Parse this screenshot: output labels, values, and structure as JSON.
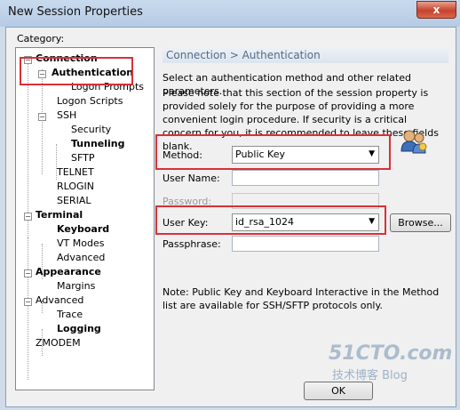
{
  "window": {
    "title": "New Session Properties",
    "close_glyph": "x"
  },
  "category_label": "Category:",
  "tree": [
    {
      "label": "Connection",
      "bold": true
    },
    {
      "label": "Authentication",
      "bold": true,
      "selected": true
    },
    {
      "label": "Logon Prompts"
    },
    {
      "label": "Logon Scripts"
    },
    {
      "label": "SSH"
    },
    {
      "label": "Security"
    },
    {
      "label": "Tunneling",
      "bold": true
    },
    {
      "label": "SFTP"
    },
    {
      "label": "TELNET"
    },
    {
      "label": "RLOGIN"
    },
    {
      "label": "SERIAL"
    },
    {
      "label": "Terminal",
      "bold": true
    },
    {
      "label": "Keyboard",
      "bold": true
    },
    {
      "label": "VT Modes"
    },
    {
      "label": "Advanced"
    },
    {
      "label": "Appearance",
      "bold": true
    },
    {
      "label": "Margins"
    },
    {
      "label": "Advanced"
    },
    {
      "label": "Trace"
    },
    {
      "label": "Logging",
      "bold": true
    },
    {
      "label": "ZMODEM"
    }
  ],
  "panel": {
    "header": "Connection > Authentication",
    "intro": "Select an authentication method and other related parameters.",
    "note": "Please note that this section of the session property is provided solely for the purpose of providing a more convenient login procedure. If security is a critical concern for you, it is recommended to leave these fields blank.",
    "method_label": "Method:",
    "method_value": "Public Key",
    "username_label": "User Name:",
    "username_value": "",
    "password_label": "Password:",
    "userkey_label": "User Key:",
    "userkey_value": "id_rsa_1024",
    "browse_label": "Browse...",
    "passphrase_label": "Passphrase:",
    "passphrase_value": "",
    "footer_note": "Note: Public Key and Keyboard Interactive in the Method list are available for SSH/SFTP protocols only."
  },
  "buttons": {
    "ok": "OK"
  },
  "watermark": {
    "line1": "51CTO.com",
    "line2": "技术博客 Blog"
  },
  "colors": {
    "highlight": "#d9303a",
    "header_text": "#536b86"
  }
}
